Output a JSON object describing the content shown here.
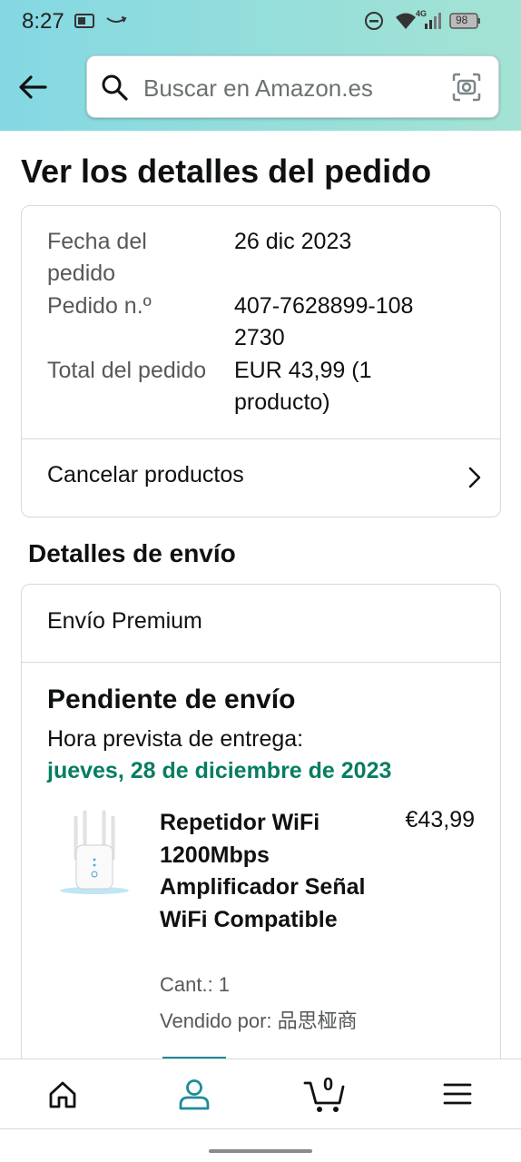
{
  "status_bar": {
    "time": "8:27",
    "network": "4G",
    "battery": "98"
  },
  "search": {
    "placeholder": "Buscar en Amazon.es"
  },
  "page": {
    "title": "Ver los detalles del pedido"
  },
  "order": {
    "date_label": "Fecha del pedido",
    "date_value": "26 dic 2023",
    "number_label": "Pedido n.º",
    "number_value": "407-7628899-1082730",
    "total_label": "Total del pedido",
    "total_value": "EUR 43,99",
    "total_count": "(1 producto)",
    "cancel_label": "Cancelar productos"
  },
  "shipping": {
    "section_title": "Detalles de envío",
    "type": "Envío Premium",
    "status": "Pendiente de envío",
    "eta_label": "Hora prevista de entrega:",
    "eta_date": "jueves, 28 de diciembre de 2023",
    "product": {
      "name": "Repetidor WiFi 1200Mbps Amplificador Señal WiFi Compatible",
      "price": "€43,99",
      "quantity": "Cant.: 1",
      "seller": "Vendido por: 品思桠商"
    }
  },
  "nav": {
    "items": [
      "home-icon",
      "account-icon",
      "cart-icon",
      "menu-icon"
    ],
    "active": "account-icon",
    "cart_count": "0"
  },
  "colors": {
    "accent": "#1f8a9a",
    "delivery_green": "#067d62",
    "header_gradient_start": "#84d8e3",
    "header_gradient_end": "#a4e3d3"
  }
}
